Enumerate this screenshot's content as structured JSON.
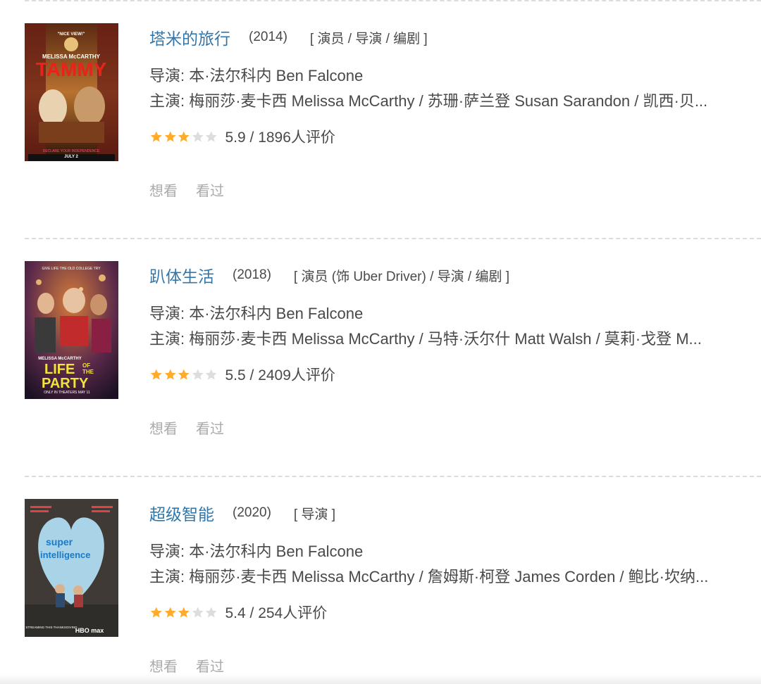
{
  "films": [
    {
      "title": "塔米的旅行",
      "year": "(2014)",
      "roles": "[ 演员 / 导演 / 编剧 ]",
      "director": "导演: 本·法尔科内 Ben Falcone",
      "cast": "主演: 梅丽莎·麦卡西 Melissa McCarthy / 苏珊·萨兰登 Susan Sarandon / 凯西·贝...",
      "stars": 3,
      "rating": "5.9 / 1896人评价",
      "poster": {
        "tagline": "\"NICE VIEW!\"",
        "actress": "MELISSA McCARTHY",
        "name": "TAMMY",
        "bottom": "DECLARE YOUR INDEPENDENCE",
        "date": "JULY 2"
      },
      "want": "想看",
      "seen": "看过"
    },
    {
      "title": "趴体生活",
      "year": "(2018)",
      "roles": "[ 演员 (饰 Uber Driver) / 导演 / 编剧 ]",
      "director": "导演: 本·法尔科内 Ben Falcone",
      "cast": "主演: 梅丽莎·麦卡西 Melissa McCarthy / 马特·沃尔什 Matt Walsh / 莫莉·戈登 M...",
      "stars": 3,
      "rating": "5.5 / 2409人评价",
      "poster": {
        "tagline": "GIVE LIFE THE OLD COLLEGE TRY",
        "actress": "MELISSA McCARTHY",
        "name1": "LIFE",
        "of": "OF",
        "the": "THE",
        "name2": "PARTY",
        "date": "ONLY IN THEATERS MAY 11"
      },
      "want": "想看",
      "seen": "看过"
    },
    {
      "title": "超级智能",
      "year": "(2020)",
      "roles": "[ 导演 ]",
      "director": "导演: 本·法尔科内 Ben Falcone",
      "cast": "主演: 梅丽莎·麦卡西 Melissa McCarthy / 詹姆斯·柯登 James Corden / 鲍比·坎纳...",
      "stars": 3,
      "rating": "5.4 / 254人评价",
      "poster": {
        "name1": "super",
        "name2": "intelligence",
        "bottom": "STREAMING THIS THANKSGIVING",
        "brand": "HBO max"
      },
      "want": "想看",
      "seen": "看过"
    }
  ],
  "colors": {
    "link": "#3377aa",
    "star_on": "#ffac2d",
    "star_off": "#dddddd",
    "muted": "#aaaaaa"
  }
}
